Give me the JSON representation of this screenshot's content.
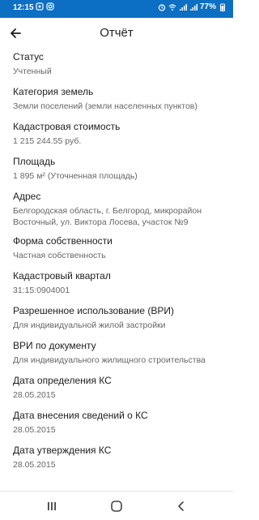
{
  "status_bar": {
    "time": "12:15",
    "battery": "77%"
  },
  "appbar": {
    "title": "Отчёт"
  },
  "fields": [
    {
      "label": "Статус",
      "value": "Учтенный"
    },
    {
      "label": "Категория земель",
      "value": "Земли поселений (земли населенных пунктов)"
    },
    {
      "label": "Кадастровая стоимость",
      "value": "1 215 244.55 руб."
    },
    {
      "label": "Площадь",
      "value": "1 895 м² (Уточненная площадь)"
    },
    {
      "label": "Адрес",
      "value": "Белгородская область, г. Белгород, микрорайон Восточный, ул. Виктора Лосева, участок №9"
    },
    {
      "label": "Форма собственности",
      "value": "Частная собственность"
    },
    {
      "label": "Кадастровый квартал",
      "value": "31:15:0904001"
    },
    {
      "label": "Разрешенное использование (ВРИ)",
      "value": "Для индивидуальной жилой застройки"
    },
    {
      "label": "ВРИ по документу",
      "value": "Для индивидуального жилищного строительства"
    },
    {
      "label": "Дата определения КС",
      "value": "28.05.2015"
    },
    {
      "label": "Дата внесения сведений о КС",
      "value": "28.05.2015"
    },
    {
      "label": "Дата утверждения КС",
      "value": "28.05.2015"
    }
  ]
}
